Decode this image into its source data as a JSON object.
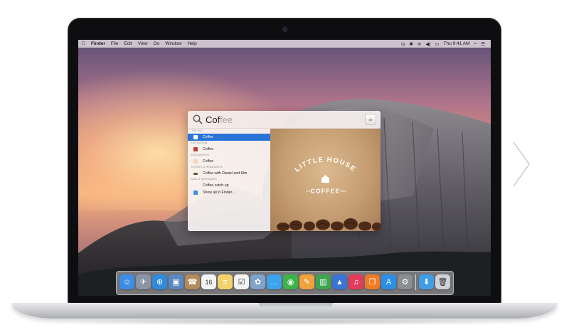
{
  "menubar": {
    "apple_icon": "apple-logo",
    "items": [
      "Finder",
      "File",
      "Edit",
      "View",
      "Go",
      "Window",
      "Help"
    ],
    "clock": "Thu 9:41 AM"
  },
  "spotlight": {
    "query_typed": "Cof",
    "query_completion": "fee",
    "categories": [
      {
        "label": "TOP HIT",
        "rows": [
          {
            "label": "Coffee",
            "icon": "app-icon",
            "selected": true
          }
        ]
      },
      {
        "label": "DEFINITION",
        "rows": [
          {
            "label": "Coffee",
            "icon": "dictionary-icon",
            "selected": false
          }
        ]
      },
      {
        "label": "DOCUMENTS",
        "rows": [
          {
            "label": "Coffee",
            "icon": "document-icon",
            "selected": false
          }
        ]
      },
      {
        "label": "EVENTS & REMINDERS",
        "rows": [
          {
            "label": "Coffee with Daniel and Kim",
            "icon": "calendar-icon",
            "selected": false
          }
        ]
      },
      {
        "label": "MAIL & MESSAGES",
        "rows": [
          {
            "label": "Coffee catch-up",
            "icon": "mail-icon",
            "selected": false
          },
          {
            "label": "Show all in Finder...",
            "icon": "finder-icon",
            "selected": false
          }
        ]
      }
    ],
    "preview": {
      "line1": "LITTLE HOUSE",
      "line2": "COFFEE",
      "est": "EST",
      "year": "1924"
    }
  },
  "dock": {
    "apps": [
      {
        "name": "finder",
        "color": "#3d8ce6",
        "glyph": "☺"
      },
      {
        "name": "launchpad",
        "color": "#8a95a6",
        "glyph": "✈"
      },
      {
        "name": "safari",
        "color": "#2f8ad9",
        "glyph": "⊕"
      },
      {
        "name": "preview",
        "color": "#5b88c2",
        "glyph": "▣"
      },
      {
        "name": "contacts",
        "color": "#b48a5a",
        "glyph": "☎"
      },
      {
        "name": "calendar",
        "color": "#f3f3f3",
        "glyph": "16"
      },
      {
        "name": "notes",
        "color": "#f2d36b",
        "glyph": "≡"
      },
      {
        "name": "reminders",
        "color": "#f4f4f4",
        "glyph": "☑"
      },
      {
        "name": "photos",
        "color": "#7fa4c9",
        "glyph": "✿"
      },
      {
        "name": "messages",
        "color": "#3aa3ea",
        "glyph": "…"
      },
      {
        "name": "facetime",
        "color": "#3bb54a",
        "glyph": "◉"
      },
      {
        "name": "pages",
        "color": "#f0a33a",
        "glyph": "✎"
      },
      {
        "name": "numbers",
        "color": "#3ba54f",
        "glyph": "▥"
      },
      {
        "name": "keynote",
        "color": "#3b73d6",
        "glyph": "▲"
      },
      {
        "name": "itunes",
        "color": "#e43a5c",
        "glyph": "♫"
      },
      {
        "name": "ibooks",
        "color": "#f07b23",
        "glyph": "❐"
      },
      {
        "name": "app-store",
        "color": "#2b8fe8",
        "glyph": "A"
      },
      {
        "name": "system-preferences",
        "color": "#8b8e93",
        "glyph": "⚙"
      }
    ],
    "stack": [
      {
        "name": "downloads-folder",
        "color": "#3f9ee3",
        "glyph": "⬇"
      },
      {
        "name": "trash",
        "color": "#cfd3d8",
        "glyph": "🗑"
      }
    ]
  },
  "colors": {
    "selection": "#2a74d8",
    "bezel": "#0e0e10"
  }
}
